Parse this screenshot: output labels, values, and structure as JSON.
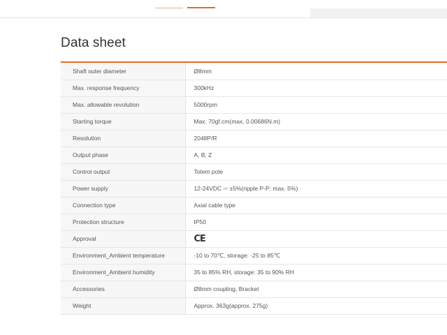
{
  "page": {
    "title": "Data sheet"
  },
  "datasheet": {
    "rows": [
      {
        "label": "Shaft outer diameter",
        "value": "Ø8mm"
      },
      {
        "label": "Max. response frequency",
        "value": "300kHz"
      },
      {
        "label": "Max. allowable revolution",
        "value": "5000rpm"
      },
      {
        "label": "Starting torque",
        "value": "Max. 70gf.cm(max. 0.00686N.m)"
      },
      {
        "label": "Resolution",
        "value": "2048P/R"
      },
      {
        "label": "Output phase",
        "value": "A, B, Z"
      },
      {
        "label": "Control output",
        "value": "Totem pole"
      },
      {
        "label": "Power supply",
        "value": "12-24VDC ⎓ ±5%(ripple P-P: max. 5%)"
      },
      {
        "label": "Connection type",
        "value": "Axial cable type"
      },
      {
        "label": "Protection structure",
        "value": "IP50"
      },
      {
        "label": "Approval",
        "value": "CE",
        "icon": "ce-mark-icon"
      },
      {
        "label": "Environment_Ambient temperature",
        "value": "-10 to 70℃, storage: -25 to 85℃"
      },
      {
        "label": "Environment_Ambient humidity",
        "value": "35 to 85% RH, storage: 35 to 90% RH"
      },
      {
        "label": "Accessories",
        "value": "Ø8mm coupling, Bracket"
      },
      {
        "label": "Weight",
        "value": "Approx. 363g(approx. 275g)"
      }
    ]
  },
  "colors": {
    "accent": "#e8672c",
    "label_bg": "#f7f7f7",
    "text": "#555555",
    "border": "#e6e6e6"
  }
}
